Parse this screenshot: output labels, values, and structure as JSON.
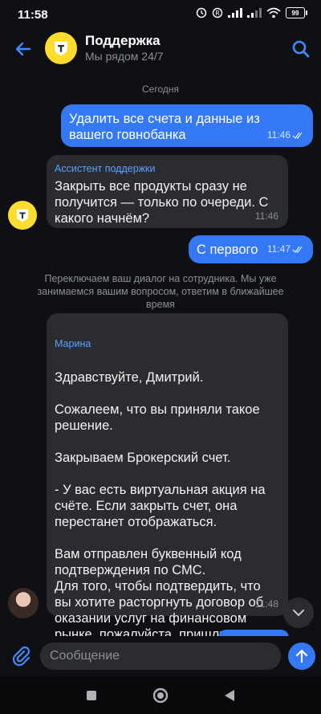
{
  "status_bar": {
    "time": "11:58",
    "battery": "99"
  },
  "header": {
    "title": "Поддержка",
    "subtitle": "Мы рядом 24/7"
  },
  "chat": {
    "day_label": "Сегодня",
    "messages": [
      {
        "direction": "out",
        "text": "Удалить все счета и данные из вашего говнобанка",
        "time": "11:46",
        "read": true
      },
      {
        "direction": "in",
        "author": "Ассистент поддержки",
        "text": "Закрыть все продукты сразу не получится — только по очереди. С какого начнём?",
        "time": "11:46"
      },
      {
        "direction": "out",
        "text": "С первого",
        "time": "11:47",
        "read": true
      },
      {
        "direction": "in",
        "author": "Марина",
        "text": "Здравствуйте, Дмитрий.\n\nСожалеем, что вы приняли такое решение.\n\nЗакрываем Брокерский счет.\n\n- У вас есть виртуальная акция на счёте. Если закрыть счет, она перестанет отображаться.\n\nВам отправлен буквенный код подтверждения по СМС.\nДля того, чтобы подтвердить, что вы хотите расторгнуть договор об оказании услуг на финансовом рынке, пожалуйста, пришлите код в чат.",
        "time": "11:48"
      }
    ],
    "system_note": "Переключаем ваш диалог на сотрудника. Мы уже занимаемся вашим вопросом, ответим в ближайшее время"
  },
  "input": {
    "placeholder": "Сообщение",
    "value": ""
  },
  "colors": {
    "accent": "#3478f6",
    "brand": "#ffdd2d",
    "background": "#0f1013",
    "incoming_bubble": "#2b2c30"
  },
  "icons": {
    "back": "arrow-left-icon",
    "search": "search-icon",
    "attach": "paperclip-icon",
    "send": "arrow-up-icon",
    "read": "double-check-icon",
    "scroll": "chevron-down-icon"
  }
}
